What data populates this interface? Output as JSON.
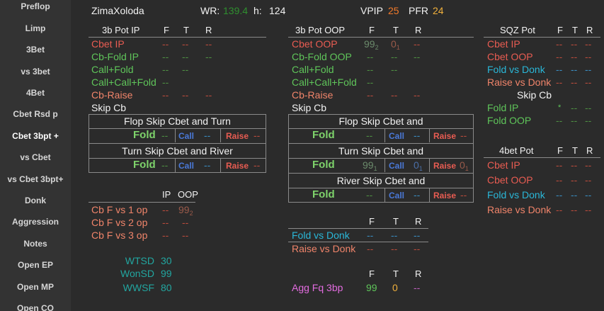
{
  "sidebar": {
    "items": [
      "Preflop",
      "Limp",
      "3Bet",
      "vs 3bet",
      "4Bet",
      "Cbet Rsd p",
      "Cbet 3bpt +",
      "vs Cbet",
      "vs Cbet 3bpt+",
      "Donk",
      "Aggression",
      "Notes",
      "Open EP",
      "Open MP",
      "Open CO"
    ],
    "active_index": 6
  },
  "header": {
    "player": "ZimaXoloda",
    "wr_label": "WR:",
    "wr_value": "139.4",
    "h_label": "h:",
    "h_value": "124",
    "vpip_label": "VPIP",
    "vpip_value": "25",
    "pfr_label": "PFR",
    "pfr_value": "24"
  },
  "ip_panel": {
    "title": "3b  Pot IP",
    "col_f": "F",
    "col_t": "T",
    "col_r": "R",
    "rows": [
      {
        "label": "Cbet IP",
        "f": "--",
        "t": "--",
        "r": "--"
      },
      {
        "label": "Cb-Fold IP",
        "f": "--",
        "t": "--",
        "r": "--"
      },
      {
        "label": "Call+Fold",
        "f": "--",
        "t": "--"
      },
      {
        "label": "Call+Call+Fold",
        "f": "--"
      },
      {
        "label": "Cb-Raise",
        "f": "--",
        "t": "--",
        "r": "--"
      }
    ],
    "skip_cb": "Skip Cb",
    "flop_title": "Flop Skip Cbet and Turn",
    "turn_title": "Turn Skip Cbet and River",
    "fold": "Fold",
    "call": "Call",
    "raise": "Raise",
    "fold_val_1": "--",
    "call_val_1": "--",
    "raise_val_1": "--",
    "fold_val_2": "--",
    "call_val_2": "--",
    "raise_val_2": "--"
  },
  "oop_panel": {
    "title": "3b  Pot OOP",
    "col_f": "F",
    "col_t": "T",
    "col_r": "R",
    "rows": [
      {
        "label": "Cbet OOP",
        "f": "99",
        "f_sub": "2",
        "t": "0",
        "t_sub": "1",
        "r": "--"
      },
      {
        "label": "Cb-Fold OOP",
        "f": "--",
        "t": "--",
        "r": "--"
      },
      {
        "label": "Call+Fold",
        "f": "--",
        "t": "--"
      },
      {
        "label": "Call+Call+Fold",
        "f": "--"
      },
      {
        "label": "Cb-Raise",
        "f": "--",
        "t": "--",
        "r": "--"
      }
    ],
    "skip_cb": "Skip Cb",
    "flop_title": "Flop Skip Cbet and",
    "turn_title": "Turn Skip Cbet and",
    "river_title": "River Skip Cbet and",
    "fold": "Fold",
    "call": "Call",
    "raise": "Raise",
    "fold_val_1": "--",
    "call_val_1": "--",
    "raise_val_1": "--",
    "fold_val_2": "99",
    "fold_sub_2": "1",
    "call_val_2": "0",
    "call_sub_2": "1",
    "raise_val_2": "0",
    "raise_sub_2": "1",
    "fold_val_3": "--",
    "call_val_3": "--",
    "raise_val_3": "--"
  },
  "cbf_panel": {
    "col_ip": "IP",
    "col_oop": "OOP",
    "rows": [
      {
        "label": "Cb F vs 1 op",
        "ip": "--",
        "oop": "99",
        "oop_sub": "2"
      },
      {
        "label": "Cb F vs 2 op",
        "ip": "--",
        "oop": "--"
      },
      {
        "label": "Cb F vs 3 op",
        "ip": "--",
        "oop": "--"
      }
    ]
  },
  "sd_stats": [
    {
      "label": "WTSD",
      "value": "30"
    },
    {
      "label": "WonSD",
      "value": "99"
    },
    {
      "label": "WWSF",
      "value": "80"
    }
  ],
  "donk_panel": {
    "col_f": "F",
    "col_t": "T",
    "col_r": "R",
    "rows": [
      {
        "label": "Fold vs Donk",
        "f": "--",
        "t": "--",
        "r": "--"
      },
      {
        "label": "Raise vs Donk",
        "f": "--",
        "t": "--",
        "r": "--"
      }
    ]
  },
  "agg_panel": {
    "col_f": "F",
    "col_t": "T",
    "col_r": "R",
    "label": "Agg Fq 3bp",
    "f": "99",
    "t": "0",
    "r": "--"
  },
  "sqz_panel": {
    "title": "SQZ Pot",
    "col_f": "F",
    "col_t": "T",
    "col_r": "R",
    "rows": [
      {
        "label": "Cbet IP",
        "f": "--",
        "t": "--",
        "r": "--"
      },
      {
        "label": "Cbet OOP",
        "f": "--",
        "t": "--",
        "r": "--"
      },
      {
        "label": "Fold vs Donk",
        "f": "--",
        "t": "--",
        "r": "--"
      },
      {
        "label": "Raise vs Donk",
        "f": "--",
        "t": "--",
        "r": "--"
      }
    ],
    "skip_cb": "Skip Cb",
    "skip_rows": [
      {
        "label": "Fold IP",
        "f": "*",
        "t": "--",
        "r": "--"
      },
      {
        "label": "Fold OOP",
        "f": "--",
        "t": "--",
        "r": "--"
      }
    ]
  },
  "fourbet_panel": {
    "title": "4bet Pot",
    "col_f": "F",
    "col_t": "T",
    "col_r": "R",
    "rows": [
      {
        "label": "Cbet IP",
        "f": "--",
        "t": "--",
        "r": "--"
      },
      {
        "label": "Cbet OOP",
        "f": "--",
        "t": "--",
        "r": "--"
      },
      {
        "label": "Fold vs Donk",
        "f": "--",
        "t": "--",
        "r": "--"
      },
      {
        "label": "Raise vs Donk",
        "f": "--",
        "t": "--",
        "r": "--"
      }
    ]
  },
  "colors": {
    "background": "#2b2b2b",
    "sidebar": "#333333",
    "red": "#e85c52",
    "green": "#5fc55a",
    "cyan": "#2ab7d8",
    "gold": "#f0b03c",
    "teal": "#22a6a0",
    "violet": "#e36ce0",
    "blue": "#4a79d8"
  }
}
